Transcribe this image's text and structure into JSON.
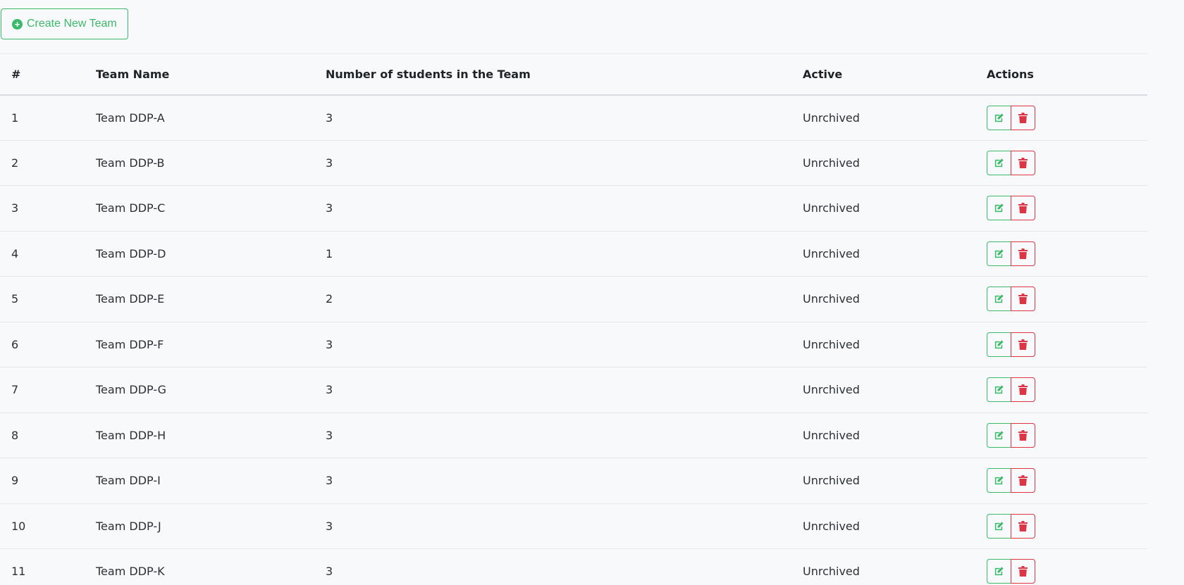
{
  "toolbar": {
    "create_label": "Create New Team",
    "create_icon": "plus-circle-icon"
  },
  "colors": {
    "accent_green": "#3cb96b",
    "danger_red": "#dc3545"
  },
  "table": {
    "headers": {
      "num": "#",
      "name": "Team Name",
      "count": "Number of students in the Team",
      "active": "Active",
      "actions": "Actions"
    },
    "rows": [
      {
        "num": "1",
        "name": "Team DDP-A",
        "count": "3",
        "active": "Unrchived"
      },
      {
        "num": "2",
        "name": "Team DDP-B",
        "count": "3",
        "active": "Unrchived"
      },
      {
        "num": "3",
        "name": "Team DDP-C",
        "count": "3",
        "active": "Unrchived"
      },
      {
        "num": "4",
        "name": "Team DDP-D",
        "count": "1",
        "active": "Unrchived"
      },
      {
        "num": "5",
        "name": "Team DDP-E",
        "count": "2",
        "active": "Unrchived"
      },
      {
        "num": "6",
        "name": "Team DDP-F",
        "count": "3",
        "active": "Unrchived"
      },
      {
        "num": "7",
        "name": "Team DDP-G",
        "count": "3",
        "active": "Unrchived"
      },
      {
        "num": "8",
        "name": "Team DDP-H",
        "count": "3",
        "active": "Unrchived"
      },
      {
        "num": "9",
        "name": "Team DDP-I",
        "count": "3",
        "active": "Unrchived"
      },
      {
        "num": "10",
        "name": "Team DDP-J",
        "count": "3",
        "active": "Unrchived"
      },
      {
        "num": "11",
        "name": "Team DDP-K",
        "count": "3",
        "active": "Unrchived"
      }
    ],
    "row_icons": {
      "edit": "edit-icon",
      "delete": "trash-icon"
    }
  }
}
